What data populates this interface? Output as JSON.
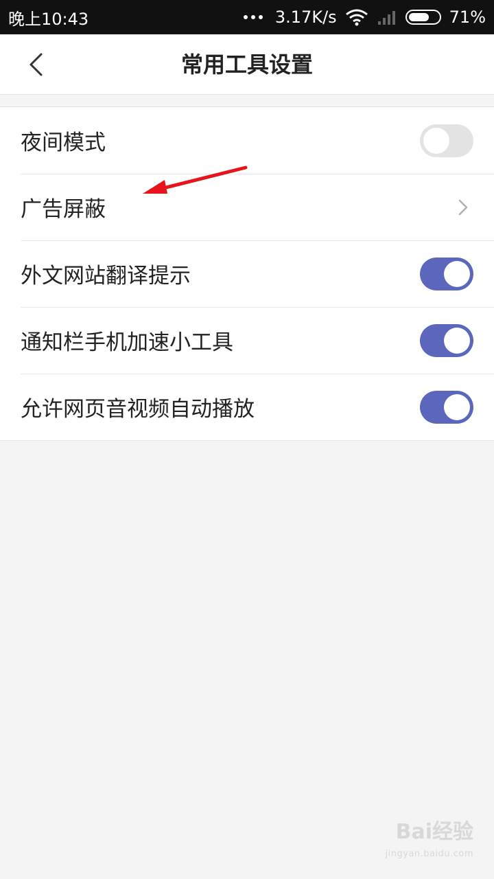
{
  "status_bar": {
    "time": "晚上10:43",
    "network_speed": "3.17K/s",
    "battery": "71%",
    "battery_level": 0.71,
    "icons": [
      "more-dots-icon",
      "wifi-icon",
      "signal-icon",
      "battery-icon"
    ]
  },
  "header": {
    "title": "常用工具设置",
    "back_icon": "chevron-left-icon"
  },
  "settings": {
    "items": [
      {
        "label": "夜间模式",
        "control": "toggle",
        "on": false
      },
      {
        "label": "广告屏蔽",
        "control": "chevron"
      },
      {
        "label": "外文网站翻译提示",
        "control": "toggle",
        "on": true
      },
      {
        "label": "通知栏手机加速小工具",
        "control": "toggle",
        "on": true
      },
      {
        "label": "允许网页音视频自动播放",
        "control": "toggle",
        "on": true
      }
    ]
  },
  "colors": {
    "toggle_on": "#5b67bd",
    "toggle_off": "#e3e3e3",
    "annotation_arrow": "#e8141b"
  },
  "watermark": {
    "brand": "Bai经验",
    "url": "jingyan.baidu.com"
  }
}
